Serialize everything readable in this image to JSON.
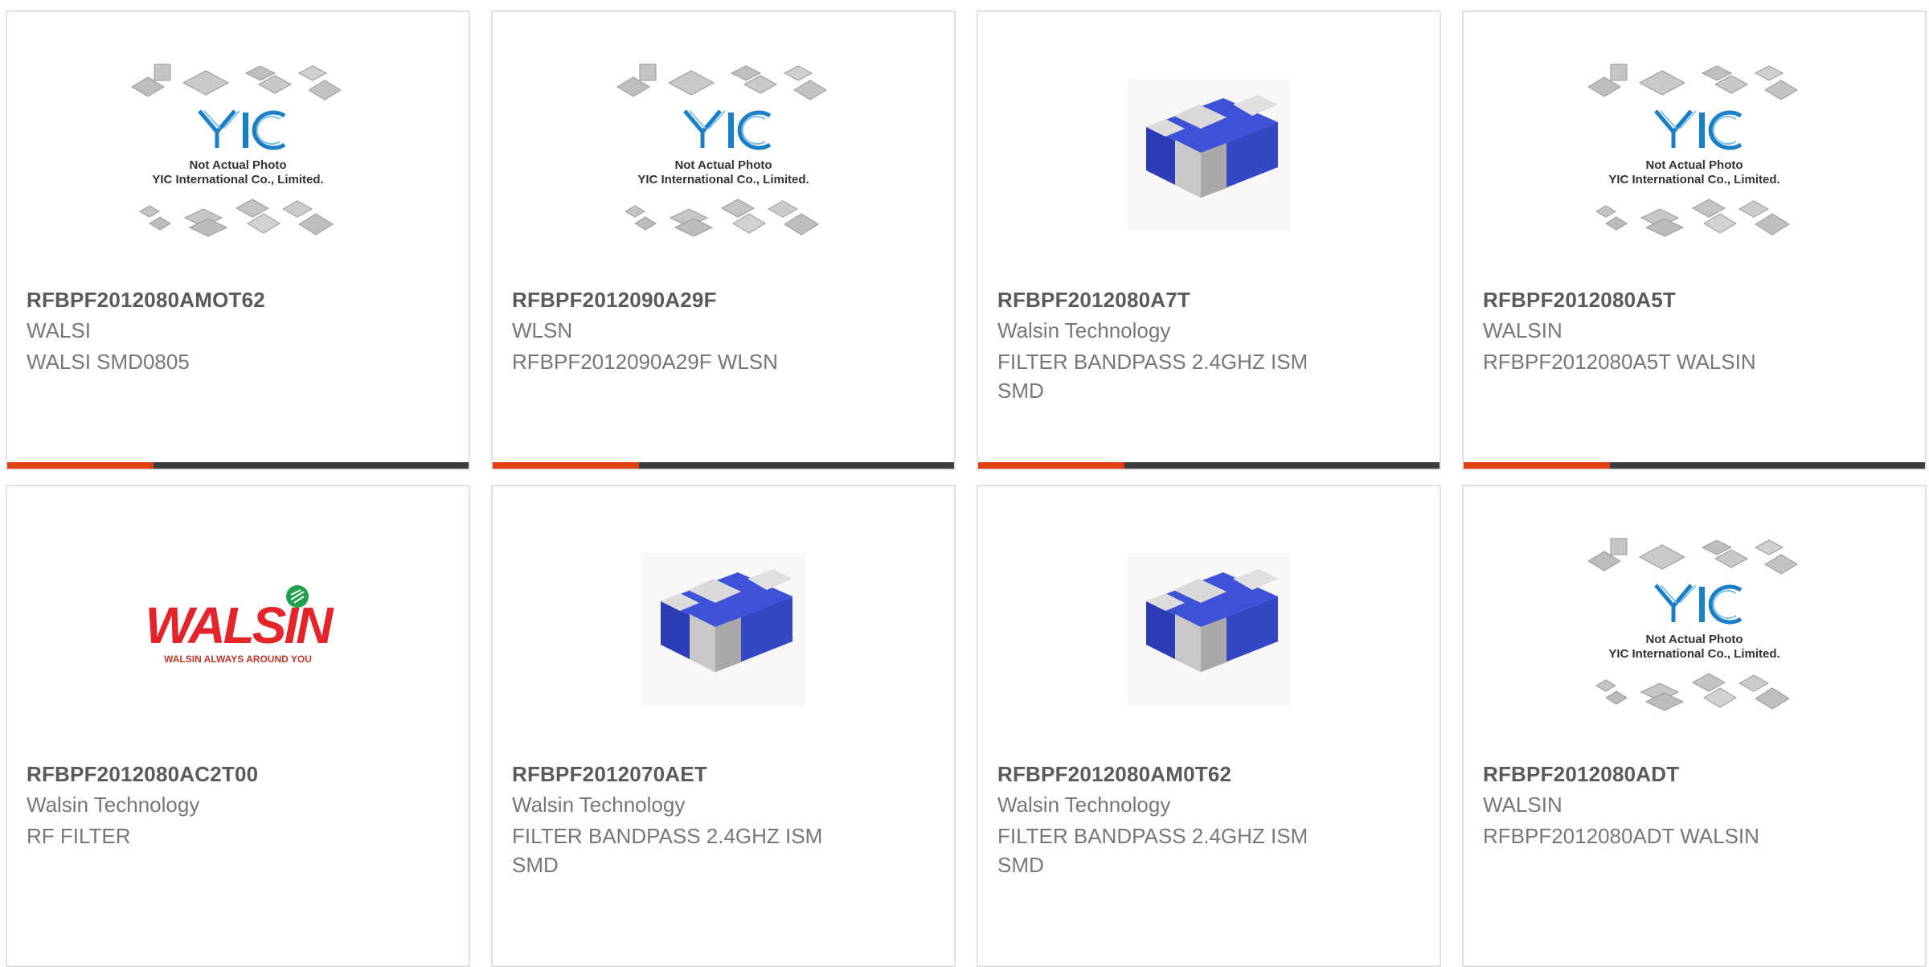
{
  "cards": [
    {
      "part": "RFBPF2012080AMOT62",
      "manufacturer": "WALSI",
      "description": "WALSI SMD0805",
      "image": "placeholder",
      "placeholder_line1": "Not Actual Photo",
      "placeholder_line2": "YIC International Co., Limited."
    },
    {
      "part": "RFBPF2012090A29F",
      "manufacturer": "WLSN",
      "description": "RFBPF2012090A29F WLSN",
      "image": "placeholder",
      "placeholder_line1": "Not Actual Photo",
      "placeholder_line2": "YIC International Co., Limited."
    },
    {
      "part": "RFBPF2012080A7T",
      "manufacturer": "Walsin Technology",
      "description": "FILTER BANDPASS 2.4GHZ ISM SMD",
      "image": "chip"
    },
    {
      "part": "RFBPF2012080A5T",
      "manufacturer": "WALSIN",
      "description": "RFBPF2012080A5T WALSIN",
      "image": "placeholder",
      "placeholder_line1": "Not Actual Photo",
      "placeholder_line2": "YIC International Co., Limited."
    },
    {
      "part": "RFBPF2012080AC2T00",
      "manufacturer": "Walsin Technology",
      "description": "RF FILTER",
      "image": "logo",
      "logo_text": "WALSIN",
      "logo_tagline": "WALSIN ALWAYS AROUND YOU"
    },
    {
      "part": "RFBPF2012070AET",
      "manufacturer": "Walsin Technology",
      "description": "FILTER BANDPASS 2.4GHZ ISM SMD",
      "image": "chip"
    },
    {
      "part": "RFBPF2012080AM0T62",
      "manufacturer": "Walsin Technology",
      "description": "FILTER BANDPASS 2.4GHZ ISM SMD",
      "image": "chip"
    },
    {
      "part": "RFBPF2012080ADT",
      "manufacturer": "WALSIN",
      "description": "RFBPF2012080ADT WALSIN",
      "image": "placeholder",
      "placeholder_line1": "Not Actual Photo",
      "placeholder_line2": "YIC International Co., Limited."
    }
  ],
  "colors": {
    "accent": "#e0400f",
    "bar": "#3d3d3d",
    "part_text": "#5a5a5a",
    "meta_text": "#777777",
    "chip_blue": "#2f45c8",
    "yic_blue": "#1a7fc4",
    "walsin_red": "#e3242b",
    "walsin_green": "#1fa04a"
  }
}
